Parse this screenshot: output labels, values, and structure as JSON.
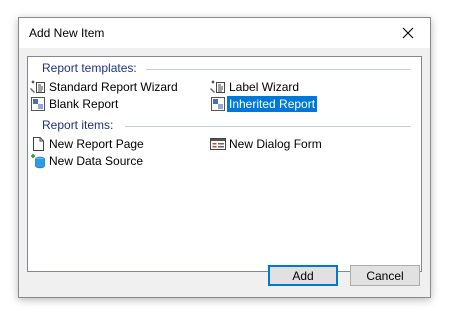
{
  "dialog": {
    "title": "Add New Item",
    "close_icon": "close-icon"
  },
  "groups": [
    {
      "header": "Report templates:",
      "items": [
        {
          "label": "Standard Report Wizard",
          "icon": "wizard-icon",
          "selected": false
        },
        {
          "label": "Label Wizard",
          "icon": "wizard-icon",
          "selected": false
        },
        {
          "label": "Blank Report",
          "icon": "report-icon",
          "selected": false
        },
        {
          "label": "Inherited Report",
          "icon": "report-icon",
          "selected": true
        }
      ]
    },
    {
      "header": "Report items:",
      "items": [
        {
          "label": "New Report Page",
          "icon": "page-icon",
          "selected": false
        },
        {
          "label": "New Dialog Form",
          "icon": "dialog-form-icon",
          "selected": false
        },
        {
          "label": "New Data Source",
          "icon": "data-source-icon",
          "selected": false
        }
      ]
    }
  ],
  "buttons": {
    "add_label": "Add",
    "cancel_label": "Cancel"
  },
  "colors": {
    "group_header": "#1e3287",
    "selection": "#0078d7"
  }
}
